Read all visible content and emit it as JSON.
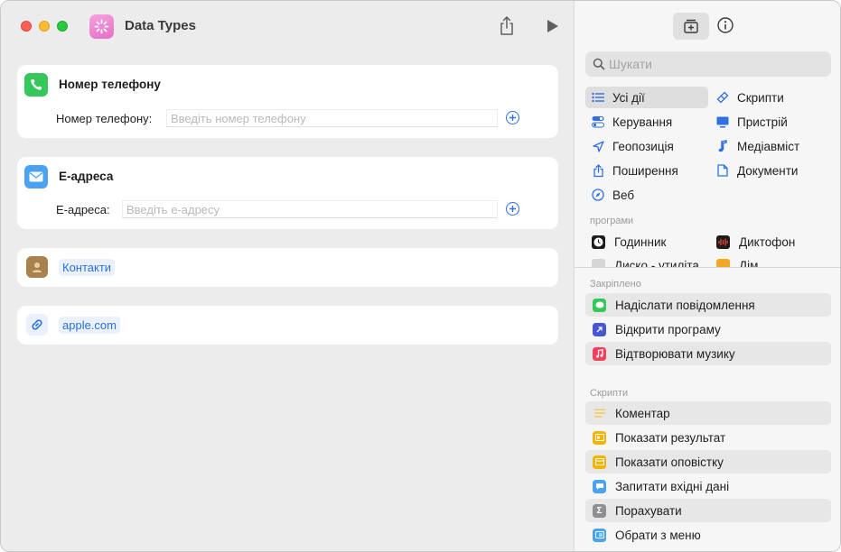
{
  "window": {
    "title": "Data Types"
  },
  "colors": {
    "accent": "#2f6fe4",
    "app_icon": "#e56dc7",
    "phone_green": "#34c759",
    "mail_blue": "#4aa3f0"
  },
  "editor": {
    "phone_card": {
      "title": "Номер телефону",
      "field_label": "Номер телефону:",
      "field_placeholder": "Введіть номер телефону",
      "field_value": ""
    },
    "email_card": {
      "title": "Е-адреса",
      "field_label": "Е-адреса:",
      "field_placeholder": "Введіть е-адресу",
      "field_value": ""
    },
    "contacts_card": {
      "token": "Контакти"
    },
    "url_card": {
      "token": "apple.com"
    }
  },
  "sidebar": {
    "search_placeholder": "Шукати",
    "categories": [
      {
        "label": "Усі дії",
        "icon": "list-icon",
        "selected": true
      },
      {
        "label": "Скрипти",
        "icon": "scripts-icon",
        "selected": false
      },
      {
        "label": "Керування",
        "icon": "toggle-icon",
        "selected": false
      },
      {
        "label": "Пристрій",
        "icon": "display-icon",
        "selected": false
      },
      {
        "label": "Геопозиція",
        "icon": "location-icon",
        "selected": false
      },
      {
        "label": "Медіавміст",
        "icon": "music-note-icon",
        "selected": false
      },
      {
        "label": "Поширення",
        "icon": "share-icon",
        "selected": false
      },
      {
        "label": "Документи",
        "icon": "document-icon",
        "selected": false
      },
      {
        "label": "Веб",
        "icon": "compass-icon",
        "selected": false
      }
    ],
    "apps_label": "програми",
    "apps": [
      {
        "label": "Годинник",
        "icon": "clock-icon"
      },
      {
        "label": "Диктофон",
        "icon": "voice-memos-icon"
      },
      {
        "label": "Диско - утиліта",
        "icon": "disk-utility-icon"
      },
      {
        "label": "Дім",
        "icon": "home-icon"
      }
    ],
    "pinned_label": "Закріплено",
    "pinned": [
      {
        "label": "Надіслати повідомлення",
        "icon": "messages-icon",
        "color": "#34c759"
      },
      {
        "label": "Відкрити програму",
        "icon": "open-app-icon",
        "color": "#4a55d6"
      },
      {
        "label": "Відтворювати музику",
        "icon": "music-icon",
        "color": "#f2405a"
      }
    ],
    "scripts_label": "Скрипти",
    "scripts": [
      {
        "label": "Коментар",
        "icon": "comment-icon",
        "color": "#f7d44a"
      },
      {
        "label": "Показати результат",
        "icon": "show-result-icon",
        "color": "#f4b400"
      },
      {
        "label": "Показати оповістку",
        "icon": "alert-icon",
        "color": "#f4b400"
      },
      {
        "label": "Запитати вхідні дані",
        "icon": "ask-input-icon",
        "color": "#4aa3f0"
      },
      {
        "label": "Порахувати",
        "icon": "sigma-icon",
        "color": "#8e8e93"
      },
      {
        "label": "Обрати з меню",
        "icon": "menu-icon",
        "color": "#4aa3f0"
      }
    ]
  }
}
